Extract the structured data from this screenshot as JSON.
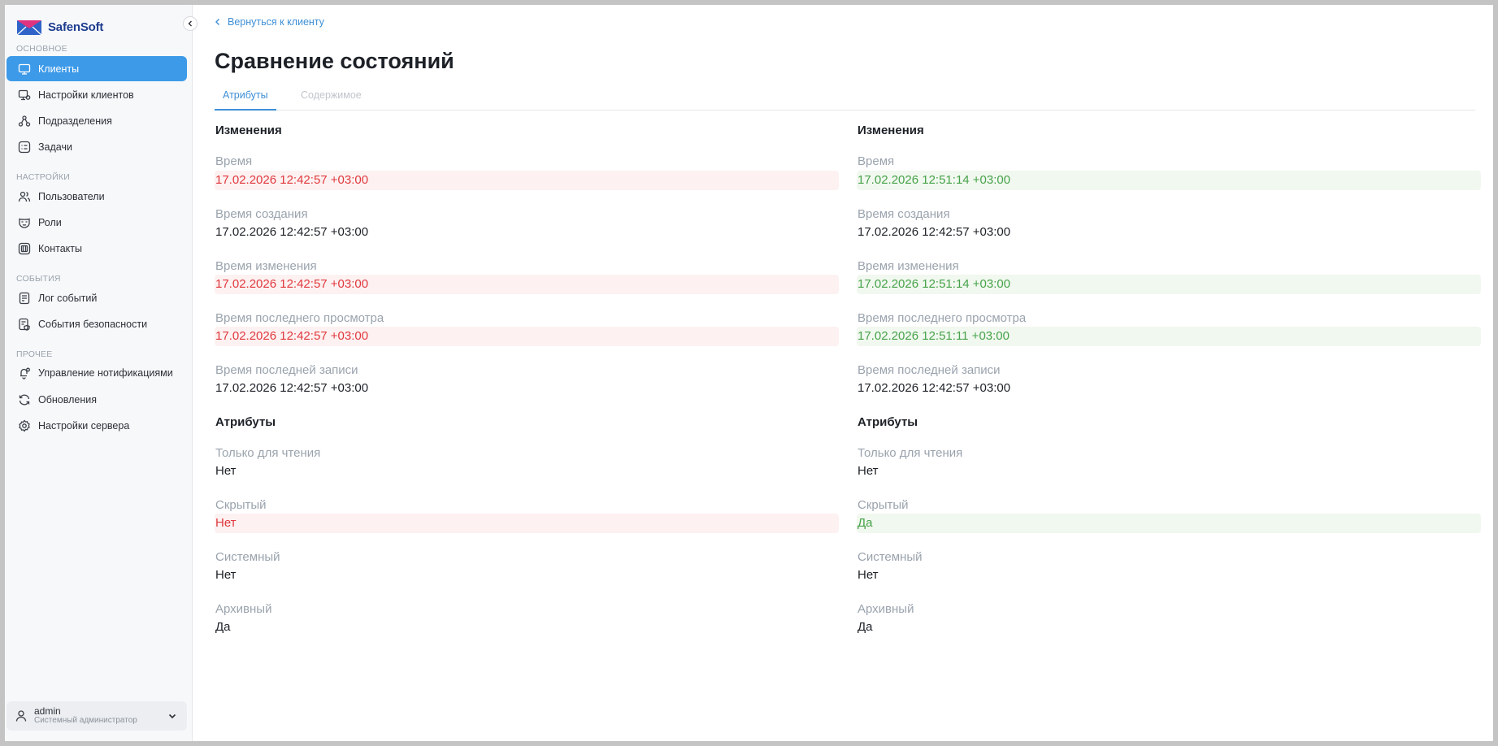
{
  "app": {
    "brand": "SafenSoft",
    "colors": {
      "accent": "#3d9ae8",
      "removed": "#e0393e",
      "added": "#46a24a"
    }
  },
  "sidebar": {
    "sections": [
      {
        "label": "ОСНОВНОЕ"
      },
      {
        "label": "НАСТРОЙКИ"
      },
      {
        "label": "СОБЫТИЯ"
      },
      {
        "label": "ПРОЧЕЕ"
      }
    ],
    "items": [
      {
        "label": "Клиенты",
        "icon": "monitor-icon",
        "active": true
      },
      {
        "label": "Настройки клиентов",
        "icon": "monitor-settings-icon"
      },
      {
        "label": "Подразделения",
        "icon": "hierarchy-icon"
      },
      {
        "label": "Задачи",
        "icon": "tasks-icon"
      },
      {
        "label": "Пользователи",
        "icon": "users-icon"
      },
      {
        "label": "Роли",
        "icon": "mask-icon"
      },
      {
        "label": "Контакты",
        "icon": "contacts-icon"
      },
      {
        "label": "Лог событий",
        "icon": "document-icon"
      },
      {
        "label": "События безопасности",
        "icon": "security-document-icon"
      },
      {
        "label": "Управление нотификациями",
        "icon": "bell-settings-icon"
      },
      {
        "label": "Обновления",
        "icon": "refresh-icon"
      },
      {
        "label": "Настройки сервера",
        "icon": "gear-icon"
      }
    ],
    "user": {
      "name": "admin",
      "role": "Системный администратор"
    }
  },
  "main": {
    "back_label": "Вернуться к клиенту",
    "title": "Сравнение состояний",
    "tabs": [
      {
        "label": "Атрибуты",
        "active": true
      },
      {
        "label": "Содержимое",
        "active": false
      }
    ],
    "columns": [
      {
        "changes_title": "Изменения",
        "time_label": "Время",
        "time_value": "17.02.2026 12:42:57 +03:00",
        "created_label": "Время создания",
        "created_value": "17.02.2026 12:42:57 +03:00",
        "modified_label": "Время изменения",
        "modified_value": "17.02.2026 12:42:57 +03:00",
        "viewed_label": "Время последнего просмотра",
        "viewed_value": "17.02.2026 12:42:57 +03:00",
        "written_label": "Время последней записи",
        "written_value": "17.02.2026 12:42:57 +03:00",
        "attributes_title": "Атрибуты",
        "readonly_label": "Только для чтения",
        "readonly_value": "Нет",
        "hidden_label": "Скрытый",
        "hidden_value": "Нет",
        "system_label": "Системный",
        "system_value": "Нет",
        "archive_label": "Архивный",
        "archive_value": "Да"
      },
      {
        "changes_title": "Изменения",
        "time_label": "Время",
        "time_value": "17.02.2026 12:51:14 +03:00",
        "created_label": "Время создания",
        "created_value": "17.02.2026 12:42:57 +03:00",
        "modified_label": "Время изменения",
        "modified_value": "17.02.2026 12:51:14 +03:00",
        "viewed_label": "Время последнего просмотра",
        "viewed_value": "17.02.2026 12:51:11 +03:00",
        "written_label": "Время последней записи",
        "written_value": "17.02.2026 12:42:57 +03:00",
        "attributes_title": "Атрибуты",
        "readonly_label": "Только для чтения",
        "readonly_value": "Нет",
        "hidden_label": "Скрытый",
        "hidden_value": "Да",
        "system_label": "Системный",
        "system_value": "Нет",
        "archive_label": "Архивный",
        "archive_value": "Да"
      }
    ]
  }
}
